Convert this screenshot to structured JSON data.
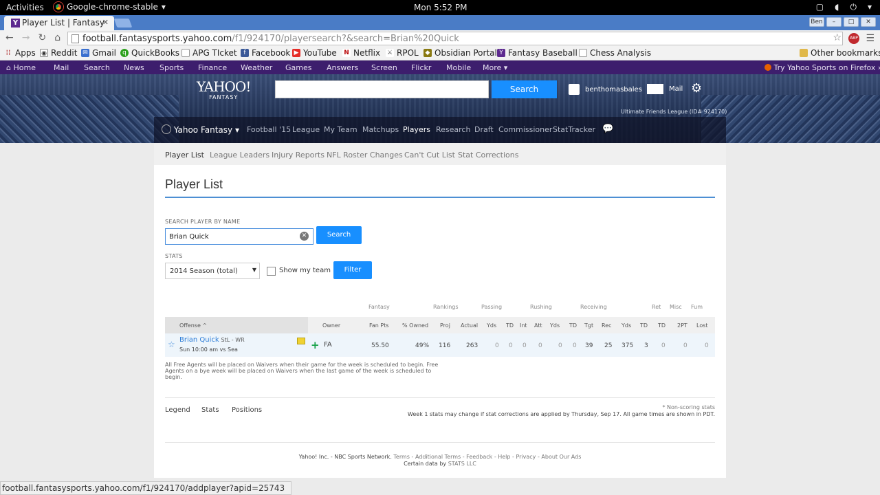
{
  "os": {
    "activities": "Activities",
    "app": "Google-chrome-stable",
    "clock": "Mon  5:52 PM"
  },
  "browser": {
    "tab_title": "Player List | Fantasy",
    "user_badge": "Ben",
    "url_host": "football.fantasysports.yahoo.com",
    "url_path": "/f1/924170/playersearch?&search=Brian%20Quick",
    "abp_badge": "ABP"
  },
  "bookmarks": [
    {
      "label": "Apps",
      "color": "#4a4a4a"
    },
    {
      "label": "Reddit",
      "color": "#888888"
    },
    {
      "label": "Gmail",
      "color": "#3a6fcf"
    },
    {
      "label": "QuickBooks",
      "color": "#2ca01c"
    },
    {
      "label": "APG TIcket",
      "color": "#aaaaaa"
    },
    {
      "label": "Facebook",
      "color": "#3b5998"
    },
    {
      "label": "YouTube",
      "color": "#e52d27"
    },
    {
      "label": "Netflix",
      "color": "#b9090b"
    },
    {
      "label": "RPOL",
      "color": "#555555"
    },
    {
      "label": "Obsidian Portal",
      "color": "#8a7a12"
    },
    {
      "label": "Fantasy Baseball",
      "color": "#5d2a8f"
    },
    {
      "label": "Chess Analysis",
      "color": "#aaaaaa"
    },
    {
      "label": "Other bookmarks",
      "color": "#e0b84a"
    }
  ],
  "ynav": [
    "Home",
    "Mail",
    "Search",
    "News",
    "Sports",
    "Finance",
    "Weather",
    "Games",
    "Answers",
    "Screen",
    "Flickr",
    "Mobile",
    "More"
  ],
  "firefox_promo": "Try Yahoo Sports on Firefox »",
  "header": {
    "logo": "YAHOO!",
    "logo_sub": "FANTASY",
    "search_btn": "Search",
    "username": "benthomasbales",
    "mail": "Mail",
    "league": "Ultimate Friends League (ID# 924170)"
  },
  "fantasy_nav": {
    "brand": "Yahoo Fantasy",
    "items": [
      "Football '15",
      "League",
      "My Team",
      "Matchups",
      "Players",
      "Research",
      "Draft",
      "Commissioner",
      "StatTracker"
    ]
  },
  "subnav": [
    "Player List",
    "League Leaders",
    "Injury Reports",
    "NFL Roster Changes",
    "Can't Cut List",
    "Stat Corrections"
  ],
  "page_title": "Player List",
  "search": {
    "label": "SEARCH PLAYER BY NAME",
    "value": "Brian Quick",
    "button": "Search"
  },
  "stats": {
    "label": "STATS",
    "selected": "2014 Season (total)",
    "show_my_team": "Show my team",
    "filter": "Filter"
  },
  "table": {
    "groups": [
      "Fantasy",
      "Rankings",
      "Passing",
      "Rushing",
      "Receiving",
      "Ret",
      "Misc",
      "Fum"
    ],
    "columns": [
      "Offense ^",
      "Owner",
      "Fan Pts",
      "% Owned",
      "Proj",
      "Actual",
      "Yds",
      "TD",
      "Int",
      "Att",
      "Yds",
      "TD",
      "Tgt",
      "Rec",
      "Yds",
      "TD",
      "TD",
      "2PT",
      "Lost"
    ],
    "row": {
      "name": "Brian Quick",
      "team_pos": "StL - WR",
      "game": "Sun 10:00 am vs Sea",
      "owner": "FA",
      "add": "+",
      "values": [
        "55.50",
        "49%",
        "116",
        "263",
        "0",
        "0",
        "0",
        "0",
        "0",
        "0",
        "39",
        "25",
        "375",
        "3",
        "0",
        "0",
        "0"
      ]
    }
  },
  "fa_note": "All Free Agents will be placed on Waivers when their game for the week is scheduled to begin. Free Agents on a bye week will be placed on Waivers when the last game of the week is scheduled to begin.",
  "bottom_tabs": [
    "Legend",
    "Stats",
    "Positions"
  ],
  "nonscoring": "* Non-scoring stats",
  "week_note": "Week 1 stats may change if stat corrections are applied by Thursday, Sep 17. All game times are shown in PDT.",
  "footer": {
    "line1": "Yahoo! Inc. - NBC Sports Network.",
    "links": "Terms - Additional Terms - Feedback - Help - Privacy - About Our Ads",
    "line2": "Certain data by",
    "stats_llc": "STATS LLC"
  },
  "status_url": "football.fantasysports.yahoo.com/f1/924170/addplayer?apid=25743"
}
